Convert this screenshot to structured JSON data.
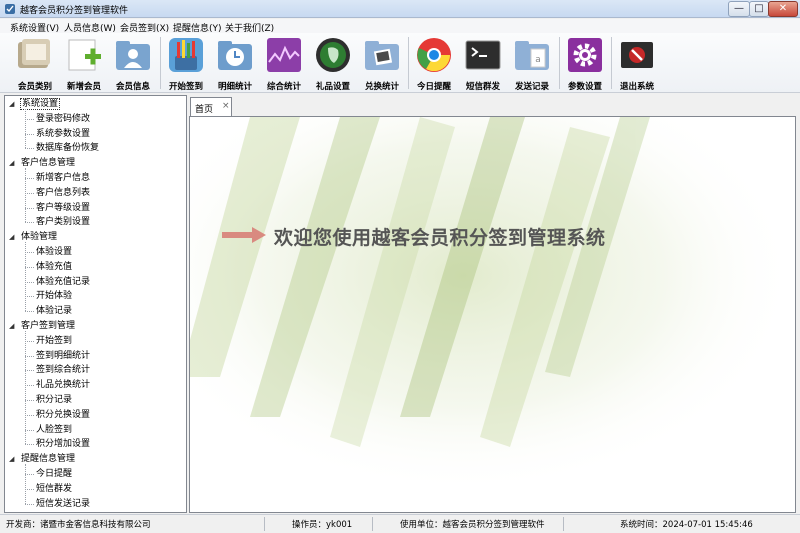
{
  "window": {
    "title": "越客会员积分签到管理软件",
    "minimize_glyph": "—",
    "maximize_glyph": "□",
    "close_glyph": "✕"
  },
  "menu": [
    {
      "label": "系统设置(V)"
    },
    {
      "label": "人员信息(W)"
    },
    {
      "label": "会员签到(X)"
    },
    {
      "label": "提醒信息(Y)"
    },
    {
      "label": "关于我们(Z)"
    }
  ],
  "toolbar": [
    {
      "label": "会员类别",
      "icon": "member-category-icon",
      "color": "#c8b99a"
    },
    {
      "label": "新增会员",
      "icon": "add-member-icon",
      "color": "#7fc24a"
    },
    {
      "label": "会员信息",
      "icon": "member-info-icon",
      "color": "#5a8fc2"
    },
    {
      "label": "开始签到",
      "icon": "pencil-cup-icon",
      "color": "#d9463a"
    },
    {
      "label": "明细统计",
      "icon": "history-clock-icon",
      "color": "#4f86c4"
    },
    {
      "label": "综合统计",
      "icon": "activity-chart-icon",
      "color": "#8c3ea8"
    },
    {
      "label": "礼品设置",
      "icon": "evernote-icon",
      "color": "#2e7d32"
    },
    {
      "label": "兑换统计",
      "icon": "photo-folder-icon",
      "color": "#6e9dcc"
    },
    {
      "label": "今日提醒",
      "icon": "chrome-icon",
      "color": "#e8a317"
    },
    {
      "label": "短信群发",
      "icon": "terminal-icon",
      "color": "#2d2d2d"
    },
    {
      "label": "发送记录",
      "icon": "document-folder-icon",
      "color": "#8fb0d6"
    },
    {
      "label": "参数设置",
      "icon": "gear-icon",
      "color": "#8a2f9e"
    },
    {
      "label": "退出系统",
      "icon": "exit-icon",
      "color": "#c62828"
    }
  ],
  "tree": [
    {
      "label": "系统设置",
      "children": [
        "登录密码修改",
        "系统参数设置",
        "数据库备份恢复"
      ]
    },
    {
      "label": "客户信息管理",
      "children": [
        "新增客户信息",
        "客户信息列表",
        "客户等级设置",
        "客户类别设置"
      ]
    },
    {
      "label": "体验管理",
      "children": [
        "体验设置",
        "体验充值",
        "体验充值记录",
        "开始体验",
        "体验记录"
      ]
    },
    {
      "label": "客户签到管理",
      "children": [
        "开始签到",
        "签到明细统计",
        "签到综合统计",
        "礼品兑换统计",
        "积分记录",
        "积分兑换设置",
        "人脸签到",
        "积分增加设置"
      ]
    },
    {
      "label": "提醒信息管理",
      "children": [
        "今日提醒",
        "短信群发",
        "短信发送记录"
      ]
    }
  ],
  "tabs": [
    {
      "label": "首页",
      "close": "×"
    }
  ],
  "welcome_text": "欢迎您使用越客会员积分签到管理系统",
  "status": {
    "developer": "开发商：诸暨市金客信息科技有限公司",
    "operator": "操作员：yk001",
    "org": "使用单位：越客会员积分签到管理软件",
    "time": "系统时间：2024-07-01 15:45:46"
  },
  "colors": {
    "accent": "#3a6ea5",
    "welcome_arrow": "#d98a80"
  }
}
